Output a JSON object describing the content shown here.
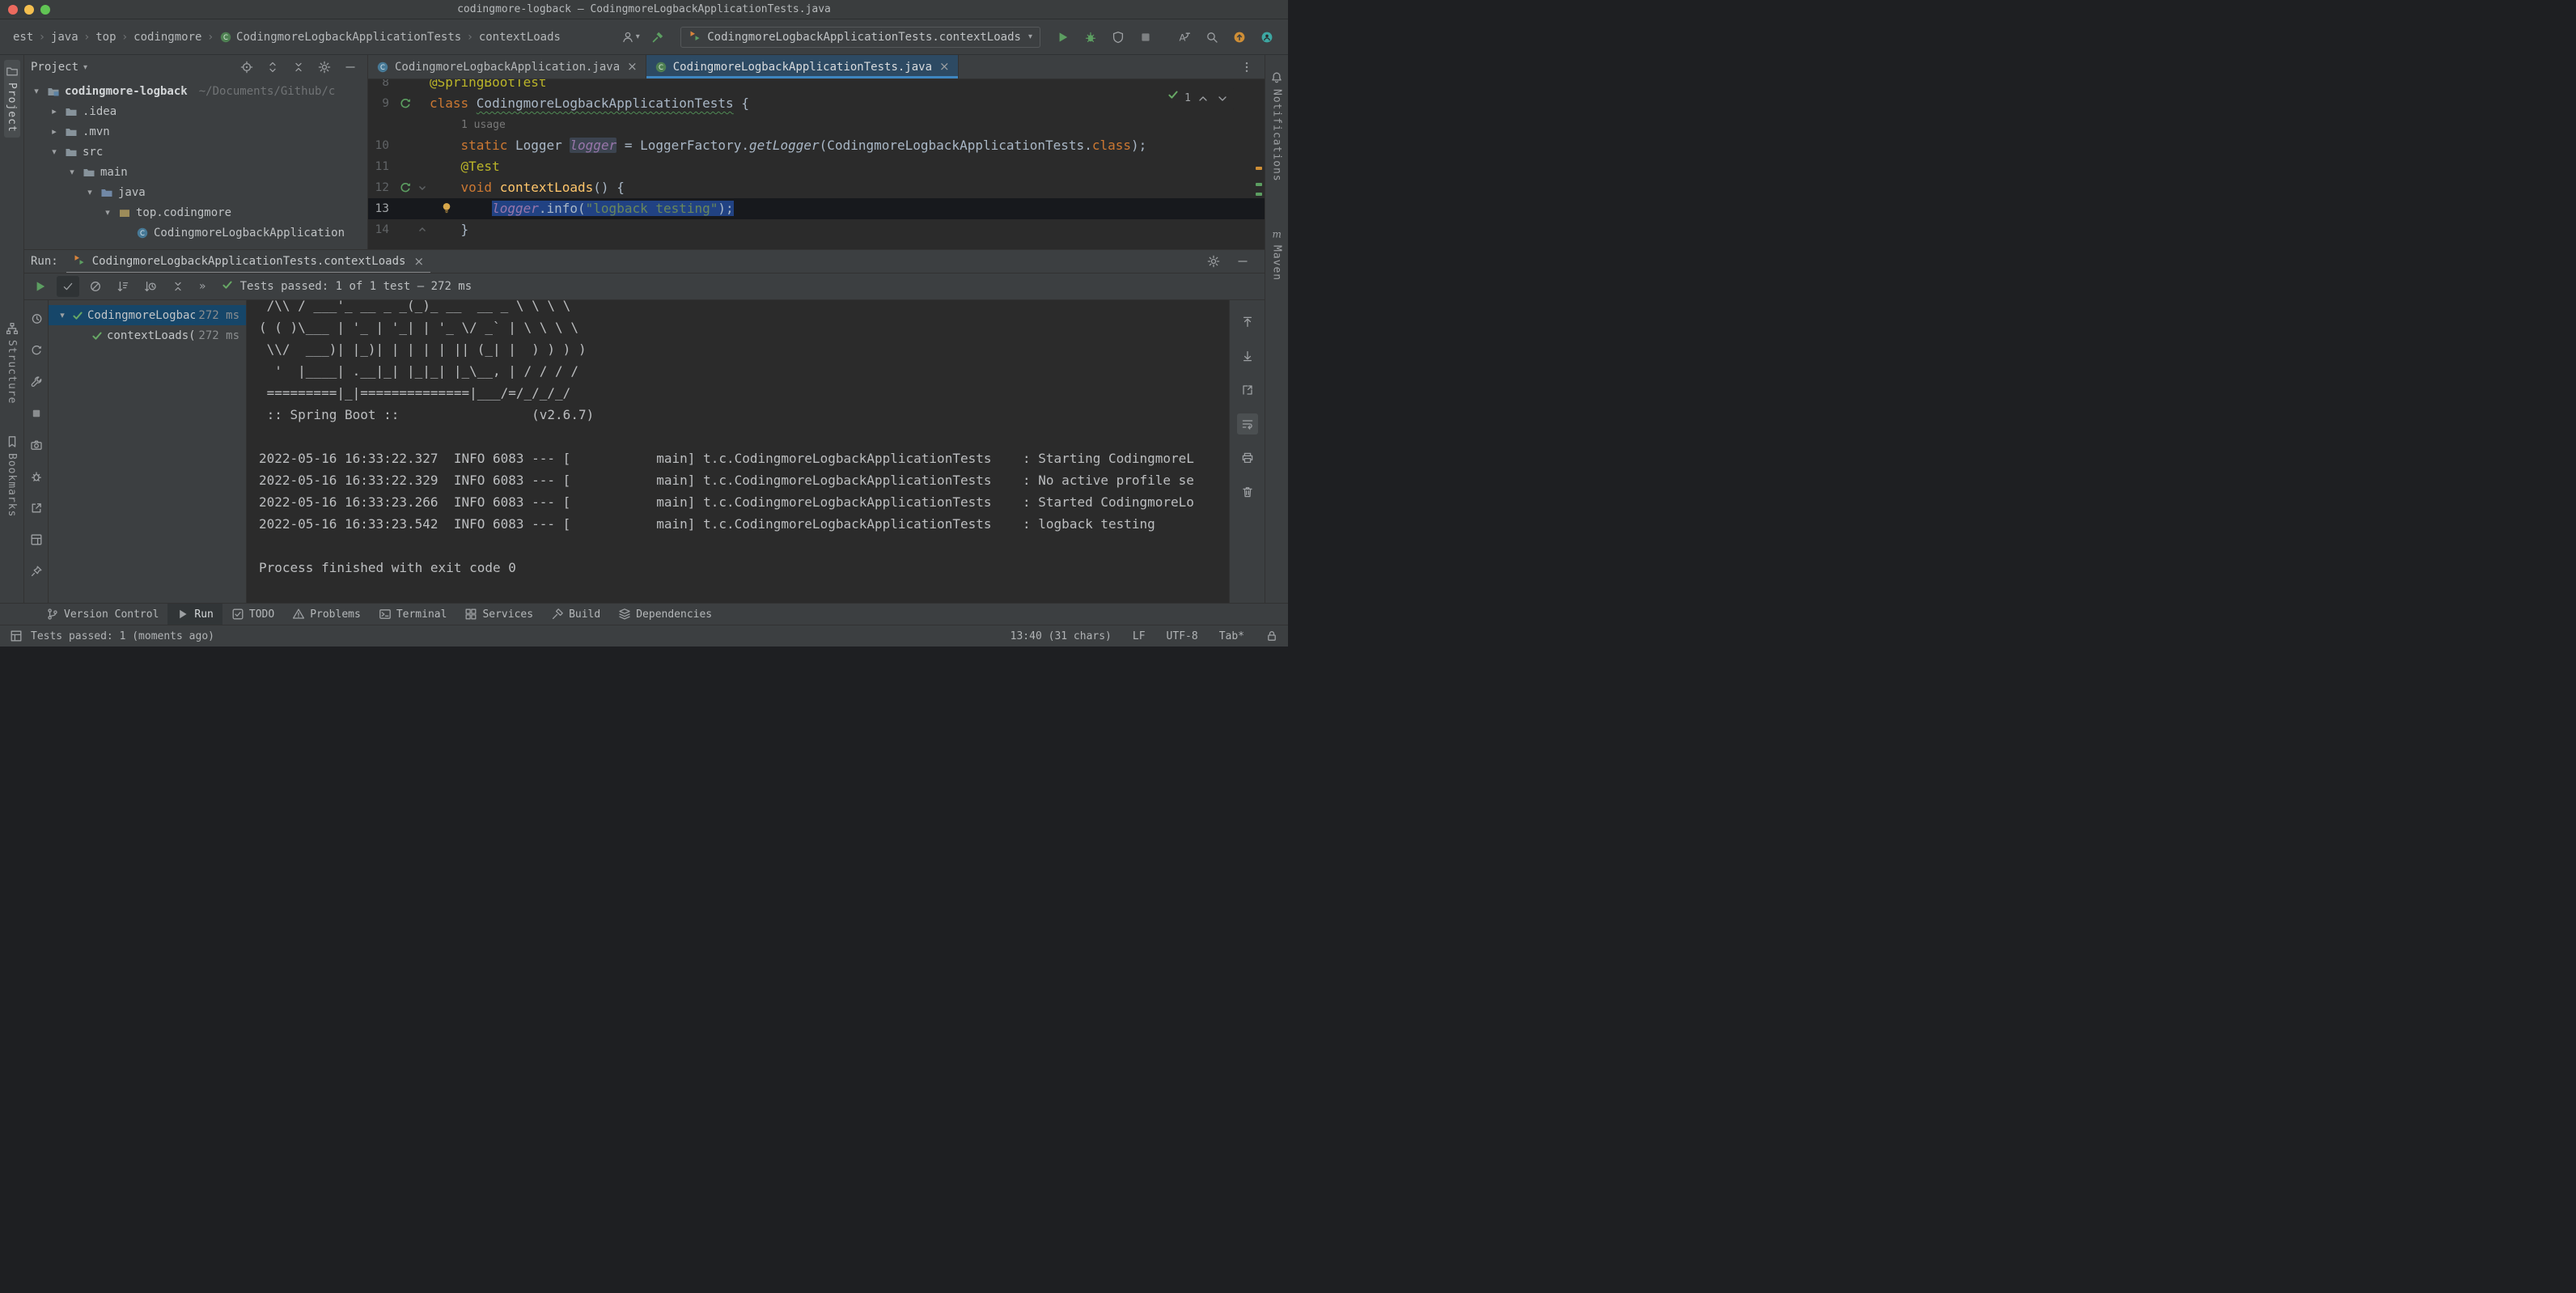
{
  "colors": {
    "accent": "#3e86c0",
    "run_green": "#5c9e61",
    "selection": "#214283",
    "editor_background": "#2b2b2b",
    "panel_background": "#3c3f41",
    "warning_orange": "#ce8e36",
    "annotation_yellow": "#bbb529",
    "keyword_orange": "#cc7832",
    "string_green": "#6a8759",
    "field_purple": "#9876aa"
  },
  "title_bar": {
    "title": "codingmore-logback – CodingmoreLogbackApplicationTests.java"
  },
  "toolbar": {
    "breadcrumbs": [
      {
        "label": "est"
      },
      {
        "label": "java"
      },
      {
        "label": "top"
      },
      {
        "label": "codingmore"
      },
      {
        "label": "CodingmoreLogbackApplicationTests",
        "icon": "test-class-icon"
      },
      {
        "label": "contextLoads"
      }
    ],
    "user_button_icon": "user-icon",
    "build_button_icon": "build-hammer-icon",
    "run_config": {
      "icon": "run-configuration-icon",
      "label": "CodingmoreLogbackApplicationTests.contextLoads"
    },
    "action_buttons": [
      {
        "name": "run-button",
        "icon": "run-icon-green"
      },
      {
        "name": "debug-button",
        "icon": "debug-icon"
      },
      {
        "name": "run-with-coverage-button",
        "icon": "coverage-icon"
      },
      {
        "name": "stop-button",
        "icon": "stop-icon"
      }
    ],
    "utility_buttons": [
      {
        "name": "translate-button",
        "icon": "translate-icon"
      },
      {
        "name": "search-everywhere-button",
        "icon": "search-icon"
      },
      {
        "name": "ide-update-button",
        "icon": "update-icon"
      },
      {
        "name": "code-with-me-button",
        "icon": "code-with-me-icon"
      }
    ]
  },
  "left_stripe": {
    "items": [
      {
        "label": "Project",
        "icon": "project-stripe-icon",
        "active": true
      },
      {
        "label": "Structure",
        "icon": "structure-icon"
      },
      {
        "label": "Bookmarks",
        "icon": "bookmarks-icon"
      }
    ]
  },
  "right_stripe": {
    "items": [
      {
        "label": "Notifications",
        "icon": "notifications-icon"
      },
      {
        "label": "Maven",
        "icon": "maven-icon"
      }
    ]
  },
  "project_panel": {
    "title": "Project",
    "header_icons": [
      {
        "name": "select-opened-file-button",
        "icon": "locate-icon"
      },
      {
        "name": "expand-all-button",
        "icon": "expand-all-icon"
      },
      {
        "name": "collapse-all-button",
        "icon": "collapse-all-icon"
      },
      {
        "name": "project-options-button",
        "icon": "settings-icon"
      },
      {
        "name": "hide-project-panel-button",
        "icon": "hide-icon"
      }
    ],
    "tree": [
      {
        "label": "codingmore-logback",
        "hint": "~/Documents/Github/c",
        "depth": 0,
        "arrow": "open",
        "icon": "folder-project-icon"
      },
      {
        "label": ".idea",
        "depth": 1,
        "arrow": "closed",
        "icon": "folder-icon"
      },
      {
        "label": ".mvn",
        "depth": 1,
        "arrow": "closed",
        "icon": "folder-icon"
      },
      {
        "label": "src",
        "depth": 1,
        "arrow": "open",
        "icon": "folder-icon"
      },
      {
        "label": "main",
        "depth": 2,
        "arrow": "open",
        "icon": "folder-icon"
      },
      {
        "label": "java",
        "depth": 3,
        "arrow": "open",
        "icon": "folder-source-icon"
      },
      {
        "label": "top.codingmore",
        "depth": 4,
        "arrow": "open",
        "icon": "package-icon"
      },
      {
        "label": "CodingmoreLogbackApplication",
        "depth": 5,
        "arrow": "none",
        "icon": "class-icon"
      }
    ]
  },
  "editor": {
    "tabs": [
      {
        "label": "CodingmoreLogbackApplication.java",
        "icon": "class-icon",
        "active": false
      },
      {
        "label": "CodingmoreLogbackApplicationTests.java",
        "icon": "test-class-icon",
        "active": true
      }
    ],
    "inspection_count": "1",
    "lines": [
      {
        "num": "8",
        "segments": [
          {
            "t": "@SpringBootTest",
            "c": "ann"
          }
        ]
      },
      {
        "num": "9",
        "gutter": "run",
        "segments": [
          {
            "t": "class ",
            "c": "kw"
          },
          {
            "t": "CodingmoreLogbackApplicationTests",
            "c": "plain",
            "wavy": true
          },
          {
            "t": " {",
            "c": "plain"
          }
        ]
      },
      {
        "num": "",
        "hint": "1 usage"
      },
      {
        "num": "10",
        "segments": [
          {
            "t": "    ",
            "c": "plain"
          },
          {
            "t": "static ",
            "c": "kw"
          },
          {
            "t": "Logger ",
            "c": "plain"
          },
          {
            "t": "logger",
            "c": "fld",
            "it": true,
            "hl": true
          },
          {
            "t": " = LoggerFactory.",
            "c": "plain"
          },
          {
            "t": "getLogger",
            "c": "plain",
            "it": true
          },
          {
            "t": "(CodingmoreLogbackApplicationTests.",
            "c": "plain"
          },
          {
            "t": "class",
            "c": "kw"
          },
          {
            "t": ");",
            "c": "plain"
          }
        ]
      },
      {
        "num": "11",
        "segments": [
          {
            "t": "    ",
            "c": "plain"
          },
          {
            "t": "@Test",
            "c": "ann"
          }
        ]
      },
      {
        "num": "12",
        "gutter": "run",
        "fold": "down",
        "segments": [
          {
            "t": "    ",
            "c": "plain"
          },
          {
            "t": "void ",
            "c": "kw"
          },
          {
            "t": "contextLoads",
            "c": "mth"
          },
          {
            "t": "() {",
            "c": "plain"
          }
        ]
      },
      {
        "num": "13",
        "bulb": true,
        "caret": true,
        "segments": [
          {
            "t": "        ",
            "c": "plain"
          },
          {
            "t": "logger",
            "c": "fld",
            "it": true,
            "sel": true
          },
          {
            "t": ".info(",
            "c": "plain",
            "sel": true
          },
          {
            "t": "\"logback testing\"",
            "c": "str",
            "sel": true
          },
          {
            "t": ");",
            "c": "plain",
            "sel": true
          }
        ]
      },
      {
        "num": "14",
        "fold": "up",
        "segments": [
          {
            "t": "    ",
            "c": "plain"
          },
          {
            "t": "}",
            "c": "plain"
          }
        ]
      }
    ]
  },
  "run_panel": {
    "label": "Run:",
    "tab": {
      "icon": "run-configuration-icon",
      "label": "CodingmoreLogbackApplicationTests.contextLoads"
    },
    "header_icons": [
      {
        "name": "run-settings-button",
        "icon": "settings-icon"
      },
      {
        "name": "hide-run-panel-button",
        "icon": "hide-icon"
      }
    ],
    "toolbar_buttons": [
      {
        "name": "rerun-tests-button",
        "icon": "run-icon-green"
      },
      {
        "name": "show-passed-button",
        "icon": "show-passed-icon",
        "active": true
      },
      {
        "name": "show-ignored-button",
        "icon": "show-ignored-icon"
      },
      {
        "name": "sort-alphabetically-button",
        "icon": "sort-alpha-icon"
      },
      {
        "name": "sort-by-duration-button",
        "icon": "sort-duration-icon"
      },
      {
        "name": "collapse-tests-button",
        "icon": "collapse-all-icon"
      }
    ],
    "more_label": "»",
    "status": "Tests passed: 1 of 1 test – 272 ms",
    "side_buttons": [
      {
        "name": "test-history-button",
        "icon": "history-icon"
      },
      {
        "name": "toggle-auto-test-button",
        "icon": "auto-test-icon"
      },
      {
        "name": "test-runner-settings-button",
        "icon": "wrench-icon"
      },
      {
        "name": "stop-process-button",
        "icon": "stop-small-icon"
      },
      {
        "name": "thread-dump-button",
        "icon": "camera-icon"
      },
      {
        "name": "attach-debugger-button",
        "icon": "bug-gray-icon"
      },
      {
        "name": "export-test-results-button",
        "icon": "export-icon"
      },
      {
        "name": "layout-settings-button",
        "icon": "layout-icon"
      },
      {
        "name": "pin-tab-button",
        "icon": "pin-icon"
      }
    ],
    "tests": [
      {
        "label": "CodingmoreLogbackApplicationTests",
        "time": "272 ms",
        "depth": 0,
        "expanded": true,
        "selected": true
      },
      {
        "label": "contextLoads()",
        "time": "272 ms",
        "depth": 1
      }
    ],
    "console_buttons": [
      {
        "name": "scroll-up-button",
        "icon": "arrow-up-icon"
      },
      {
        "name": "scroll-down-button",
        "icon": "arrow-down-icon"
      },
      {
        "name": "jump-to-source-button",
        "icon": "jump-icon"
      },
      {
        "name": "soft-wrap-button",
        "icon": "soft-wrap-icon",
        "active": true
      },
      {
        "name": "print-console-button",
        "icon": "print-icon"
      },
      {
        "name": "clear-console-button",
        "icon": "trash-icon"
      }
    ],
    "console": [
      " /\\\\ / ___'_ __ _ _(_)_ __  __ _ \\ \\ \\ \\",
      "( ( )\\___ | '_ | '_| | '_ \\/ _` | \\ \\ \\ \\",
      " \\\\/  ___)| |_)| | | | | || (_| |  ) ) ) )",
      "  '  |____| .__|_| |_|_| |_\\__, | / / / /",
      " =========|_|==============|___/=/_/_/_/",
      " :: Spring Boot ::                 (v2.6.7)",
      "",
      "2022-05-16 16:33:22.327  INFO 6083 --- [           main] t.c.CodingmoreLogbackApplicationTests    : Starting CodingmoreL",
      "2022-05-16 16:33:22.329  INFO 6083 --- [           main] t.c.CodingmoreLogbackApplicationTests    : No active profile se",
      "2022-05-16 16:33:23.266  INFO 6083 --- [           main] t.c.CodingmoreLogbackApplicationTests    : Started CodingmoreLo",
      "2022-05-16 16:33:23.542  INFO 6083 --- [           main] t.c.CodingmoreLogbackApplicationTests    : logback testing",
      "",
      "Process finished with exit code 0"
    ]
  },
  "bottom_bar": {
    "items": [
      {
        "label": "Version Control",
        "icon": "branch-icon"
      },
      {
        "label": "Run",
        "icon": "run-icon",
        "active": true
      },
      {
        "label": "TODO",
        "icon": "todo-icon"
      },
      {
        "label": "Problems",
        "icon": "problems-icon"
      },
      {
        "label": "Terminal",
        "icon": "terminal-icon"
      },
      {
        "label": "Services",
        "icon": "services-icon"
      },
      {
        "label": "Build",
        "icon": "build-icon"
      },
      {
        "label": "Dependencies",
        "icon": "dependencies-icon"
      }
    ]
  },
  "status_bar": {
    "message": "Tests passed: 1 (moments ago)",
    "caret": "13:40 (31 chars)",
    "line_sep": "LF",
    "encoding": "UTF-8",
    "indent": "Tab*"
  }
}
